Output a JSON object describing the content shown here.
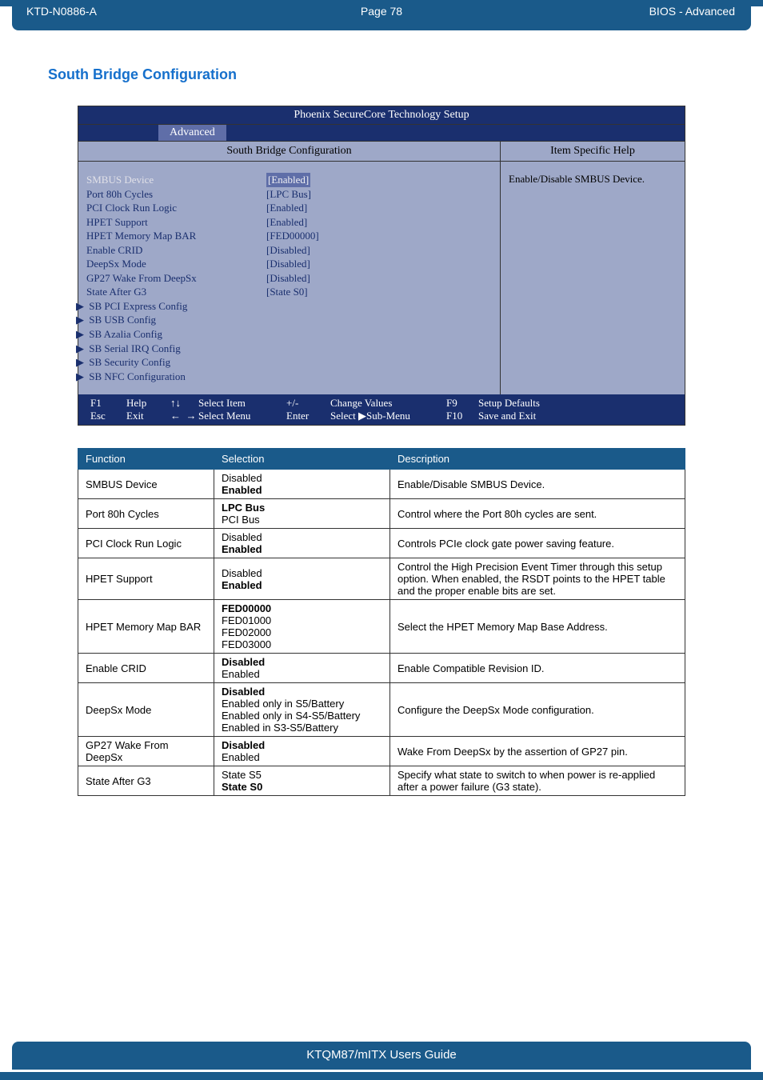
{
  "header": {
    "doc_id": "KTD-N0886-A",
    "page": "Page 78",
    "section": "BIOS  - Advanced"
  },
  "section_title": "South Bridge Configuration",
  "bios": {
    "title": "Phoenix SecureCore Technology Setup",
    "tab_active": "Advanced",
    "subheader_left": "South Bridge Configuration",
    "subheader_right": "Item Specific Help",
    "help_text": "Enable/Disable SMBUS Device.",
    "items": [
      {
        "label": "SMBUS Device",
        "value": "[Enabled]",
        "highlighted": true
      },
      {
        "label": "Port 80h Cycles",
        "value": "[LPC Bus]"
      },
      {
        "label": "PCI Clock Run Logic",
        "value": "[Enabled]"
      },
      {
        "label": "HPET Support",
        "value": "[Enabled]"
      },
      {
        "label": "HPET Memory Map BAR",
        "value": "[FED00000]"
      },
      {
        "label": "Enable CRID",
        "value": "[Disabled]"
      },
      {
        "label": "DeepSx Mode",
        "value": "[Disabled]"
      },
      {
        "label": "GP27 Wake From DeepSx",
        "value": "[Disabled]"
      },
      {
        "label": "State After G3",
        "value": "[State S0]"
      }
    ],
    "submenus": [
      "SB PCI Express Config",
      "SB USB Config",
      "SB Azalia Config",
      "SB Serial IRQ Config",
      "SB Security Config",
      "SB NFC Configuration"
    ],
    "footer": {
      "row1": {
        "k1": "F1",
        "k2": "Help",
        "k3": "↑↓",
        "k4": "Select Item",
        "k5": "+/-",
        "k6": "Change Values",
        "k7": "F9",
        "k8": "Setup Defaults"
      },
      "row2": {
        "k1": "Esc",
        "k2": "Exit",
        "k3": "←  →",
        "k4": "Select Menu",
        "k5": "Enter",
        "k6": "Select ▶Sub-Menu",
        "k7": "F10",
        "k8": "Save and Exit"
      }
    }
  },
  "table": {
    "headers": [
      "Function",
      "Selection",
      "Description"
    ],
    "rows": [
      {
        "func": "SMBUS Device",
        "sel": "Disabled\n<b>Enabled</b>",
        "desc": "Enable/Disable SMBUS Device."
      },
      {
        "func": "Port 80h Cycles",
        "sel": "<b>LPC Bus</b>\nPCI Bus",
        "desc": "Control where the Port 80h cycles are sent."
      },
      {
        "func": "PCI Clock Run Logic",
        "sel": "Disabled\n<b>Enabled</b>",
        "desc": "Controls PCIe clock gate power saving feature."
      },
      {
        "func": "HPET Support",
        "sel": "Disabled\n<b>Enabled</b>",
        "desc": "Control the High Precision Event Timer through this setup option. When enabled, the RSDT points to the HPET table and the proper enable bits are set."
      },
      {
        "func": "HPET Memory Map BAR",
        "sel": "<b>FED00000</b>\nFED01000\nFED02000\nFED03000",
        "desc": "Select the HPET Memory Map Base Address."
      },
      {
        "func": "Enable CRID",
        "sel": "<b>Disabled</b>\nEnabled",
        "desc": "Enable Compatible Revision ID."
      },
      {
        "func": "DeepSx Mode",
        "sel": "<b>Disabled</b>\nEnabled only in S5/Battery\nEnabled only in S4-S5/Battery\nEnabled in S3-S5/Battery",
        "desc": "Configure the DeepSx Mode configuration."
      },
      {
        "func": "GP27 Wake From DeepSx",
        "sel": "<b>Disabled</b>\nEnabled",
        "desc": "Wake From DeepSx by the assertion of GP27 pin."
      },
      {
        "func": "State After G3",
        "sel": "State S5\n<b>State S0</b>",
        "desc": "Specify what state to switch to when power is re-applied after a power failure (G3 state)."
      }
    ]
  },
  "footer_text": "KTQM87/mITX Users Guide"
}
